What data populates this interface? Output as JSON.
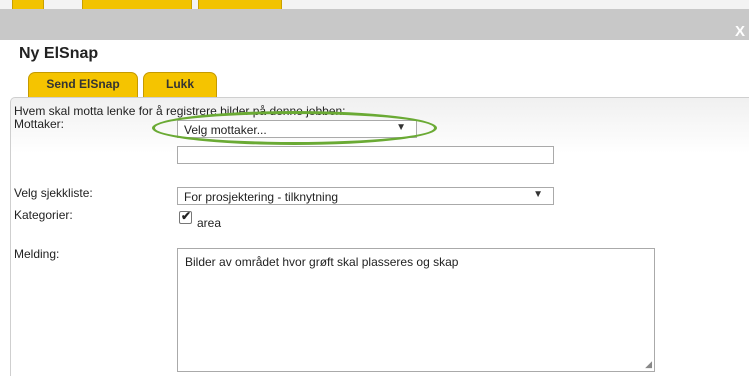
{
  "window": {
    "close_glyph": "X"
  },
  "dialog": {
    "title": "Ny ElSnap",
    "tabs": [
      {
        "label": "Send ElSnap"
      },
      {
        "label": "Lukk"
      }
    ]
  },
  "form": {
    "intro": "Hvem skal motta lenke for å registrere bilder på denne jobben:",
    "recipient_label": "Mottaker:",
    "recipient_select_value": "Velg mottaker...",
    "recipient_text_value": "",
    "checklist_label": "Velg sjekkliste:",
    "checklist_select_value": "For prosjektering - tilknytning",
    "categories_label": "Kategorier:",
    "category_option": "area",
    "category_checked": true,
    "message_label": "Melding:",
    "message_value": "Bilder av området hvor grøft skal plasseres og skap"
  },
  "colors": {
    "tab_yellow": "#f5c400",
    "highlight_green": "#6aaa34",
    "titlebar_gray": "#c8c8c8"
  },
  "icons": {
    "dropdown": "chevron-down-icon",
    "check": "checkmark-icon",
    "resize": "resize-grip-icon",
    "close": "close-icon"
  }
}
